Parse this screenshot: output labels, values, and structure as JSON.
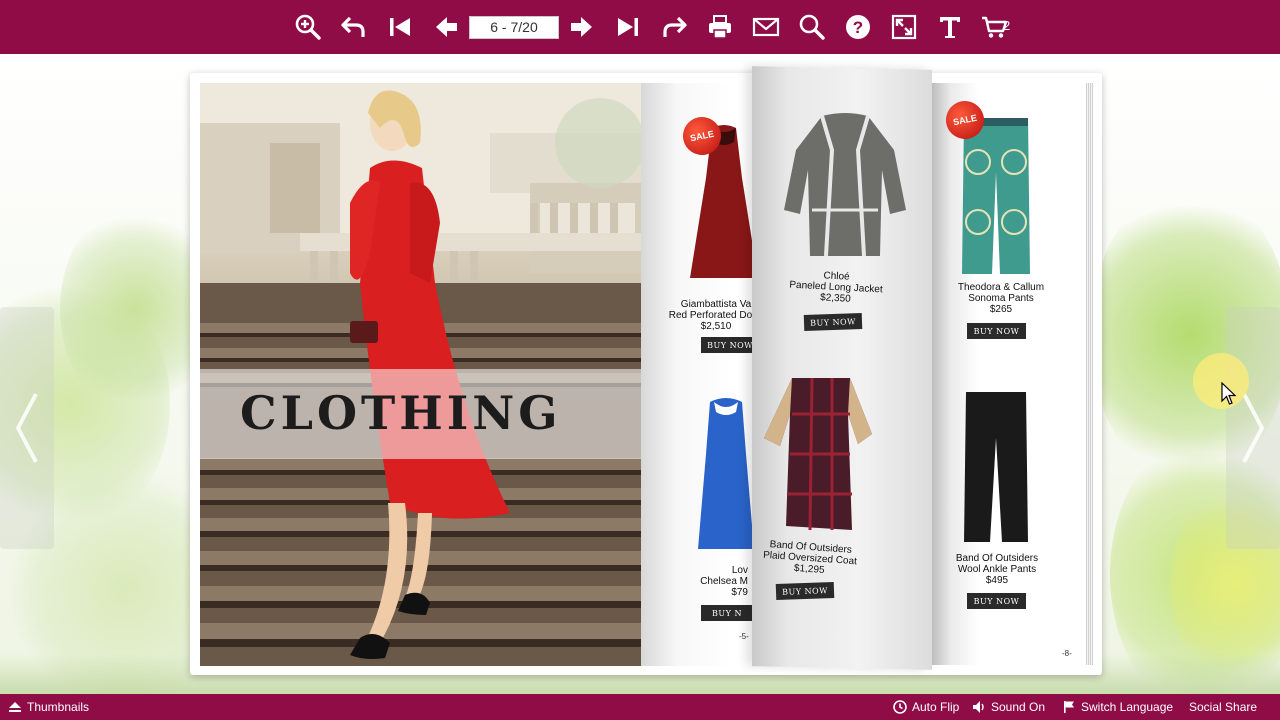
{
  "toolbar": {
    "icons": [
      "zoom-in-icon",
      "undo-icon",
      "first-page-icon",
      "prev-page-icon",
      "next-page-icon",
      "last-page-icon",
      "redo-icon",
      "print-icon",
      "email-icon",
      "search-icon",
      "help-icon",
      "fullscreen-icon",
      "text-icon",
      "cart-icon"
    ],
    "page_indicator": "6 - 7/20",
    "cart_count": "2"
  },
  "book": {
    "left_page": {
      "heading": "CLOTHING"
    },
    "products": [
      {
        "name_line1": "Giambattista Va",
        "name_line2": "Red Perforated Dotte",
        "price": "$2,510",
        "button": "BUY NOW"
      },
      {
        "name_line1": "Chloé",
        "name_line2": "Paneled Long Jacket",
        "price": "$2,350",
        "button": "BUY NOW"
      },
      {
        "name_line1": "Theodora & Callum",
        "name_line2": "Sonoma Pants",
        "price": "$265",
        "button": "BUY NOW"
      },
      {
        "name_line1": "Lov",
        "name_line2": "Chelsea M",
        "price": "$79",
        "button": "BUY N"
      },
      {
        "name_line1": "Band Of Outsiders",
        "name_line2": "Plaid Oversized Coat",
        "price": "$1,295",
        "button": "BUY NOW"
      },
      {
        "name_line1": "Band Of Outsiders",
        "name_line2": "Wool Ankle Pants",
        "price": "$495",
        "button": "BUY NOW"
      }
    ],
    "sale_badge": "SALE",
    "page_marks": [
      "-5-",
      "-8-"
    ]
  },
  "bottombar": {
    "thumbnails": "Thumbnails",
    "auto_flip": "Auto Flip",
    "sound": "Sound On",
    "switch_language": "Switch Language",
    "social_share": "Social Share"
  },
  "colors": {
    "brand": "#8f0c47",
    "button": "#2a2a2a",
    "sale": "#c81414"
  }
}
